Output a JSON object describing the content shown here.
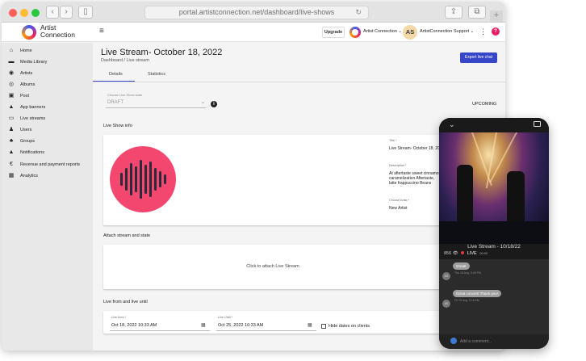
{
  "browser": {
    "url": "portal.artistconnection.net/dashboard/live-shows",
    "back_glyph": "‹",
    "forward_glyph": "›",
    "sidebar_glyph": "▯",
    "reload_glyph": "↻",
    "share_glyph": "⇪",
    "tabs_glyph": "⧉",
    "newtab_glyph": "+"
  },
  "header": {
    "logo_line1": "Artist",
    "logo_line2": "Connection",
    "menu_glyph": "≡",
    "upgrade_label": "Upgrade",
    "org_label": "Artist Connection ⌄",
    "avatar_initials": "AS",
    "user_label": "ArtistConnection Support ⌄",
    "kebab_glyph": "⋮",
    "help_glyph": "?"
  },
  "sidebar": {
    "items": [
      {
        "label": "Home",
        "icon": "home-icon",
        "glyph": "⌂"
      },
      {
        "label": "Media Library",
        "icon": "folder-icon",
        "glyph": "▬"
      },
      {
        "label": "Artists",
        "icon": "artist-icon",
        "glyph": "◉"
      },
      {
        "label": "Albums",
        "icon": "album-icon",
        "glyph": "◎"
      },
      {
        "label": "Post",
        "icon": "post-icon",
        "glyph": "▣"
      },
      {
        "label": "App banners",
        "icon": "bell-icon",
        "glyph": "▲"
      },
      {
        "label": "Live streams",
        "icon": "monitor-icon",
        "glyph": "▭"
      },
      {
        "label": "Users",
        "icon": "user-icon",
        "glyph": "♟"
      },
      {
        "label": "Groups",
        "icon": "groups-icon",
        "glyph": "♣"
      },
      {
        "label": "Notifications",
        "icon": "notification-icon",
        "glyph": "▲"
      },
      {
        "label": "Revenue and payment reports",
        "icon": "euro-icon",
        "glyph": "€"
      },
      {
        "label": "Analytics",
        "icon": "analytics-icon",
        "glyph": "▦"
      }
    ]
  },
  "page": {
    "title": "Live Stream- October 18, 2022",
    "breadcrumb": "Dashboard / Live stream",
    "export_label": "Export live chat",
    "tabs": [
      "Details",
      "Statistics"
    ],
    "state_select": {
      "label": "Choose Live Show state",
      "value": "DRAFT",
      "arrow": "⌄"
    },
    "info_glyph": "i",
    "status": "UPCOMING",
    "live_show_info_title": "Live Show info",
    "fields": {
      "title_label": "Title *",
      "title_value": "Live Stream- October 18, 2022",
      "description_label": "Description *",
      "description_value": "At aftertaste sweet cinnamon caramelization Aftertaste, latte frappuccino Beans extraction",
      "artist_label": "Choose Artist *",
      "artist_value": "New Artist"
    },
    "attach_title": "Attach stream and state",
    "attach_text": "Click to attach Live Stream",
    "live_from_title": "Live from and live until",
    "live_from": {
      "label": "Live from *",
      "value": "Oct 18, 2022 10:33 AM"
    },
    "live_until": {
      "label": "Live Until *",
      "value": "Oct 25, 2022 10:33 AM"
    },
    "calendar_glyph": "▦",
    "hide_dates_label": "Hide dates on clients"
  },
  "phone": {
    "down_glyph": "⌄",
    "title": "Live Stream - 10/18/22",
    "viewers": "856 👁",
    "live_label": "LIVE",
    "live_time": "00:00",
    "messages": [
      {
        "avatar": "AS",
        "text": "Great!",
        "time": "Thu 18 Aug, 9:49 PM"
      },
      {
        "avatar": "AS",
        "text": "Great concert! Thank you!",
        "time": "Fri 19 Aug, 9:16 AM"
      }
    ],
    "comment_placeholder": "Add a comment..."
  },
  "colors": {
    "accent": "#3547c8",
    "pink": "#f4476f",
    "help": "#e91e63"
  }
}
